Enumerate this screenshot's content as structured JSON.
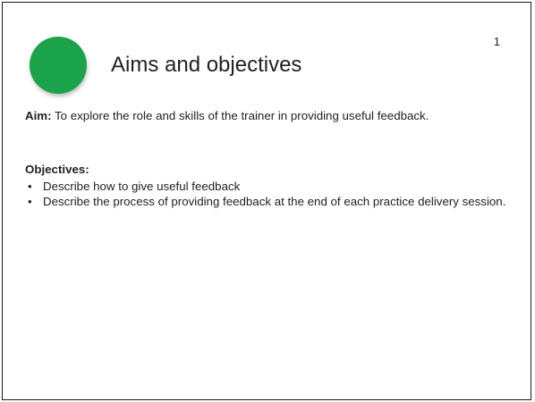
{
  "slide": {
    "number": "1",
    "title": "Aims and objectives",
    "accent_color": "#1aa34a",
    "aim_label": "Aim:",
    "aim_text": " To explore the role and skills of the trainer in providing useful feedback.",
    "objectives_heading": "Objectives:",
    "bullet_char": "•",
    "objectives": [
      "Describe how to give useful feedback",
      "Describe the process of providing feedback at the end of each practice delivery session."
    ]
  }
}
